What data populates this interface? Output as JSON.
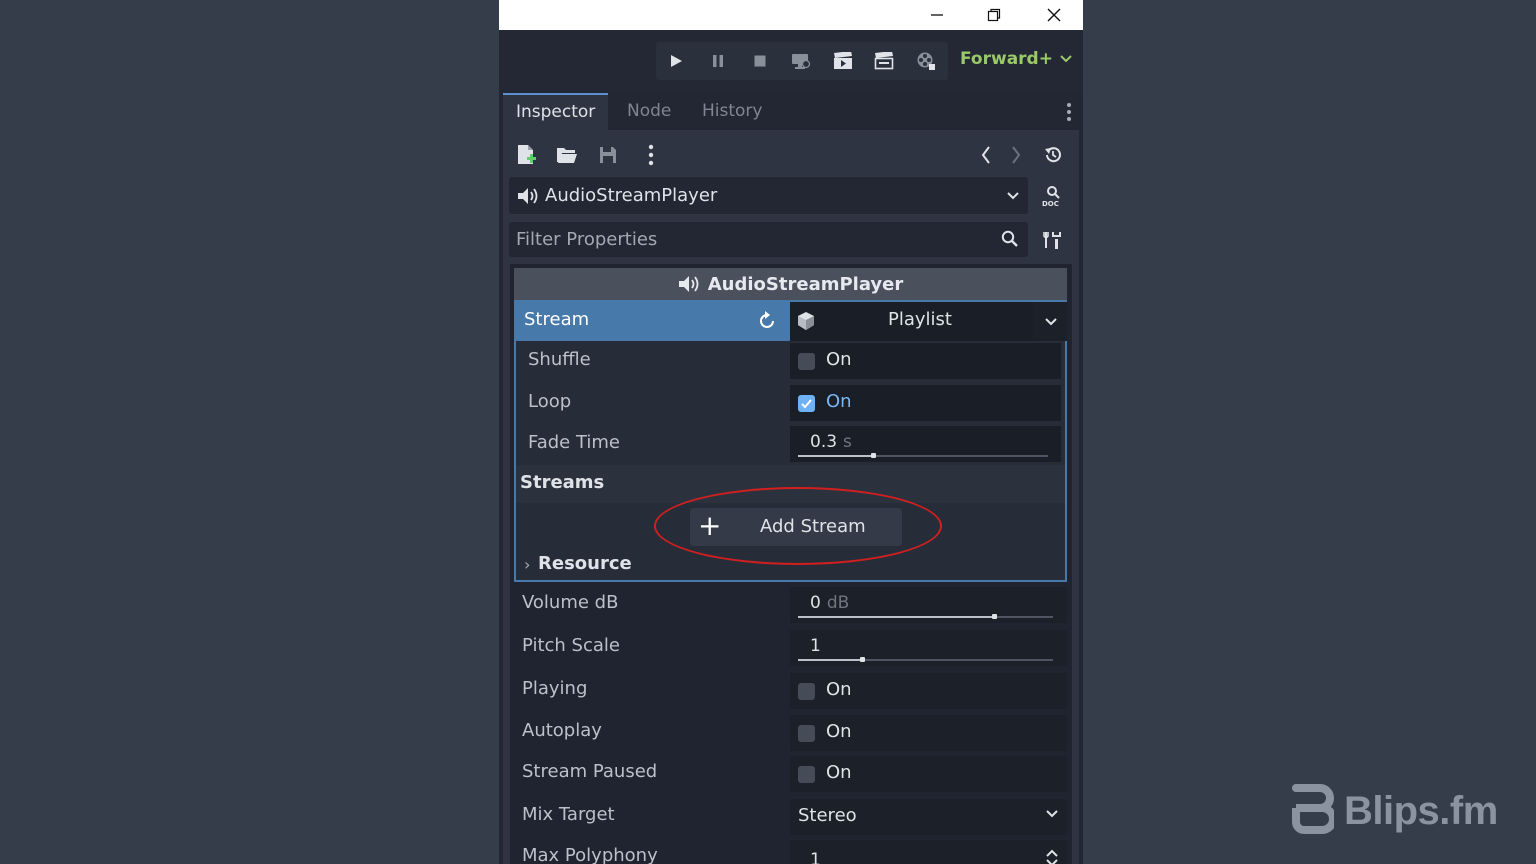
{
  "window": {
    "controls": [
      "minimize",
      "restore",
      "close"
    ]
  },
  "toolbar": {
    "buttons": [
      "play-icon",
      "pause-icon",
      "stop-icon",
      "remote-debug-icon",
      "play-scene-icon",
      "play-custom-scene-icon",
      "movie-maker-icon"
    ],
    "renderer": "Forward+"
  },
  "tabs": [
    {
      "label": "Inspector",
      "active": true
    },
    {
      "label": "Node",
      "active": false
    },
    {
      "label": "History",
      "active": false
    }
  ],
  "node_selector": {
    "value": "AudioStreamPlayer"
  },
  "filter": {
    "placeholder": "Filter Properties"
  },
  "class_header": "AudioStreamPlayer",
  "stream": {
    "label": "Stream",
    "value": "Playlist"
  },
  "playlist": {
    "shuffle": {
      "label": "Shuffle",
      "text": "On",
      "checked": false
    },
    "loop": {
      "label": "Loop",
      "text": "On",
      "checked": true
    },
    "fade_time": {
      "label": "Fade Time",
      "value": "0.3",
      "unit": "s",
      "level": 0.3
    },
    "streams_header": "Streams",
    "add_stream": "Add Stream",
    "resource": "Resource"
  },
  "properties": {
    "volume_db": {
      "label": "Volume dB",
      "value": "0",
      "unit": "dB",
      "level": 0.77
    },
    "pitch_scale": {
      "label": "Pitch Scale",
      "value": "1",
      "level": 0.25
    },
    "playing": {
      "label": "Playing",
      "text": "On",
      "checked": false
    },
    "autoplay": {
      "label": "Autoplay",
      "text": "On",
      "checked": false
    },
    "stream_paused": {
      "label": "Stream Paused",
      "text": "On",
      "checked": false
    },
    "mix_target": {
      "label": "Mix Target",
      "value": "Stereo"
    },
    "max_polyphony": {
      "label": "Max Polyphony",
      "value": "1"
    }
  },
  "watermark": "Blips.fm",
  "colors": {
    "accent": "#4779ab",
    "renderer": "#9ac96a",
    "checked": "#6fb1f5",
    "annotation": "#d21f1f"
  }
}
